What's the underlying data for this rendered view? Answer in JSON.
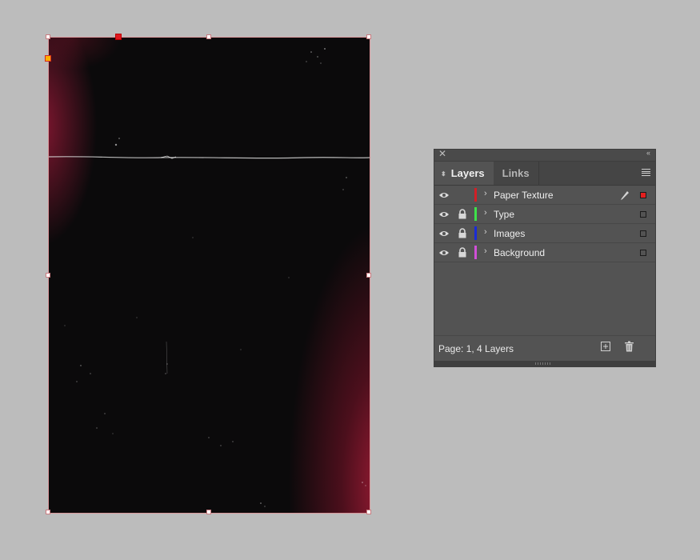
{
  "panel": {
    "tabs": [
      {
        "label": "Layers",
        "active": true
      },
      {
        "label": "Links",
        "active": false
      }
    ],
    "layers": [
      {
        "name": "Paper Texture",
        "color": "#d21f26",
        "locked": false,
        "visible": true,
        "editing": true,
        "selected": true
      },
      {
        "name": "Type",
        "color": "#3ee24a",
        "locked": true,
        "visible": true,
        "editing": false,
        "selected": false
      },
      {
        "name": "Images",
        "color": "#1a2bd6",
        "locked": true,
        "visible": true,
        "editing": false,
        "selected": false
      },
      {
        "name": "Background",
        "color": "#d14fd8",
        "locked": true,
        "visible": true,
        "editing": false,
        "selected": false
      }
    ],
    "status": "Page: 1, 4 Layers"
  },
  "icons": {
    "close": "close-icon",
    "collapse": "collapse-icon",
    "menu": "panel-menu-icon",
    "eye": "eye-icon",
    "lock": "lock-icon",
    "pen": "pen-icon",
    "new_layer": "new-layer-icon",
    "trash": "trash-icon"
  }
}
